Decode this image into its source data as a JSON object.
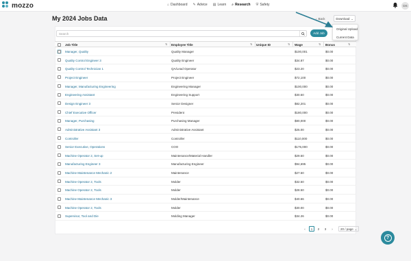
{
  "app": {
    "logo_text": "mozzo",
    "avatar_initials": "DS"
  },
  "nav": [
    {
      "label": "Dashboard",
      "icon": "home-icon"
    },
    {
      "label": "Advice",
      "icon": "advice-icon"
    },
    {
      "label": "Learn",
      "icon": "book-icon"
    },
    {
      "label": "Research",
      "icon": "research-icon",
      "active": true
    },
    {
      "label": "Safety",
      "icon": "shield-icon"
    }
  ],
  "page": {
    "title": "My 2024 Jobs Data",
    "back_label": "Back",
    "download_label": "Download",
    "search_placeholder": "Search",
    "add_job_label": "Add Job"
  },
  "download_menu": {
    "items": [
      "Original Upload",
      "Current Data"
    ]
  },
  "table": {
    "columns": [
      "Job Title",
      "Employee Title",
      "Unique ID",
      "Wage",
      "Bonus"
    ],
    "rows": [
      [
        "Manager, Quality",
        "Quality Manager",
        "",
        "$100,001",
        "$0.00"
      ],
      [
        "Quality Control Engineer 3",
        "Quality Engineer",
        "",
        "$34.87",
        "$0.00"
      ],
      [
        "Quality Control Technician 1",
        "QA/Lead Operator",
        "",
        "$23.20",
        "$0.00"
      ],
      [
        "Project Engineer",
        "Project Engineer",
        "",
        "$72,100",
        "$0.00"
      ],
      [
        "Manager, Manufacturing Engineering",
        "Engineering Manager",
        "",
        "$100,000",
        "$0.00"
      ],
      [
        "Engineering Assistant",
        "Engineering Support",
        "",
        "$30.50",
        "$0.00"
      ],
      [
        "Design Engineer 3",
        "Senior Designer",
        "",
        "$82,201",
        "$0.00"
      ],
      [
        "Chief Executive Officer",
        "President",
        "",
        "$180,000",
        "$0.00"
      ],
      [
        "Manager, Purchasing",
        "Purchasing Manager",
        "",
        "$80,000",
        "$0.00"
      ],
      [
        "Administrative Assistant 3",
        "Administrative Assistant",
        "",
        "$25.00",
        "$0.00"
      ],
      [
        "Controller",
        "Controller",
        "",
        "$110,000",
        "$0.00"
      ],
      [
        "Senior Executive, Operations",
        "COO",
        "",
        "$175,000",
        "$0.00"
      ],
      [
        "Machine Operator 2, Set-up",
        "Maintenance/Material Handler",
        "",
        "$29.50",
        "$0.00"
      ],
      [
        "Manufacturing Engineer 3",
        "Manufacturing Engineer",
        "",
        "$94,695",
        "$0.00"
      ],
      [
        "Machine Maintenance Mechanic 2",
        "Maintenance",
        "",
        "$27.50",
        "$0.00"
      ],
      [
        "Machine Operator 2, Tools",
        "Molder",
        "",
        "$32.50",
        "$0.00"
      ],
      [
        "Machine Operator 2, Tools",
        "Molder",
        "",
        "$28.50",
        "$0.00"
      ],
      [
        "Machine Maintenance Mechanic 3",
        "Molder/Maintenance",
        "",
        "$40.66",
        "$0.00"
      ],
      [
        "Machine Operator 2, Tools",
        "Molder",
        "",
        "$30.00",
        "$0.00"
      ],
      [
        "Supervisor, Tool and Die",
        "Molding Manager",
        "",
        "$34.26",
        "$0.00"
      ]
    ]
  },
  "pagination": {
    "pages": [
      "1",
      "2",
      "3"
    ],
    "current": "1",
    "per_page": "20 / page"
  },
  "colors": {
    "accent": "#2b8a9d",
    "link": "#1f6f95",
    "annotation_arrow": "#2a7d93"
  }
}
